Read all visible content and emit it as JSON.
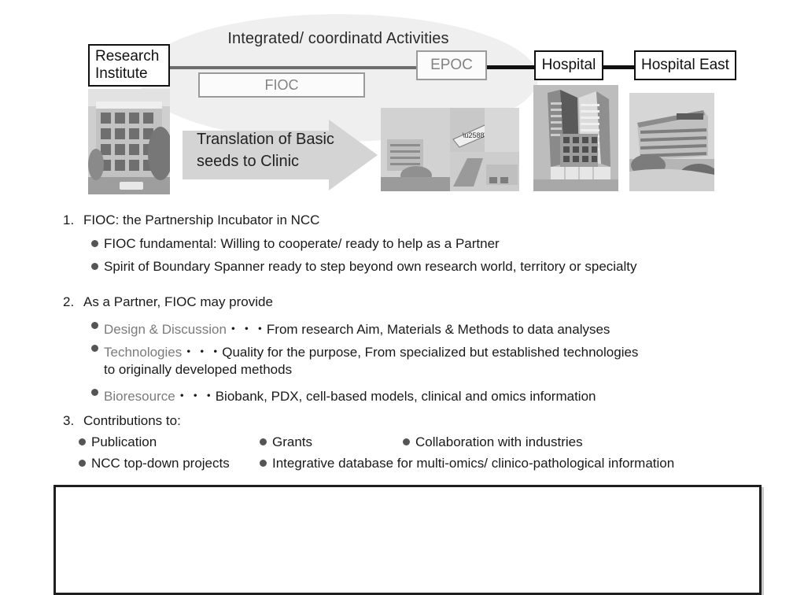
{
  "diagram": {
    "ellipse_label": "Integrated/ coordinatd Activities",
    "nodes": {
      "research_institute_line1": "Research",
      "research_institute_line2": "Institute",
      "fioc": "FIOC",
      "epoc": "EPOC",
      "hospital": "Hospital",
      "hospital_east": "Hospital East"
    },
    "arrow_label_line1": "Translation of Basic",
    "arrow_label_line2": "seeds to Clinic",
    "photos": [
      {
        "name": "research-institute-building-photo"
      },
      {
        "name": "east-hospital-collage-photo"
      },
      {
        "name": "central-hospital-building-photo"
      },
      {
        "name": "hospital-east-building-photo"
      }
    ],
    "colors": {
      "ellipse_fill": "#efefef",
      "grey_node_border": "#9a9a9a",
      "grey_node_text": "#838383",
      "dark_line": "#111111",
      "grey_line": "#6d6d6d",
      "arrow_fill": "#d4d4d4"
    }
  },
  "items": [
    {
      "number": "1.",
      "heading": "FIOC: the Partnership Incubator in NCC",
      "bullets": [
        {
          "term": "",
          "text": "FIOC fundamental: Willing to cooperate/ ready to help as a Partner"
        },
        {
          "term": "",
          "text": "Spirit of Boundary Spanner ready to step beyond own research world, territory or specialty"
        }
      ]
    },
    {
      "number": "2.",
      "heading": "As a Partner, FIOC may provide",
      "boxed": true,
      "bullets": [
        {
          "term": "Design & Discussion",
          "text": "・・・From research Aim, Materials & Methods to data analyses"
        },
        {
          "term": "Technologies",
          "text": "・・・Quality for the purpose, From specialized but established technologies",
          "wrap": "to originally developed methods"
        },
        {
          "term": "Bioresource",
          "text": "・・・Biobank, PDX, cell-based models, clinical and omics information"
        }
      ]
    },
    {
      "number": "3.",
      "heading": "Contributions to:",
      "grid_bullets": [
        {
          "text": "Publication"
        },
        {
          "text": "Grants"
        },
        {
          "text": "Collaboration with industries"
        },
        {
          "text": "NCC top-down projects"
        },
        {
          "text": "Integrative database for multi-omics/ clinico-pathological information"
        }
      ]
    }
  ],
  "text_colors": {
    "body": "#1a1a1a",
    "grey_term": "#7b7b7b",
    "bullet_dot": "#555555"
  }
}
